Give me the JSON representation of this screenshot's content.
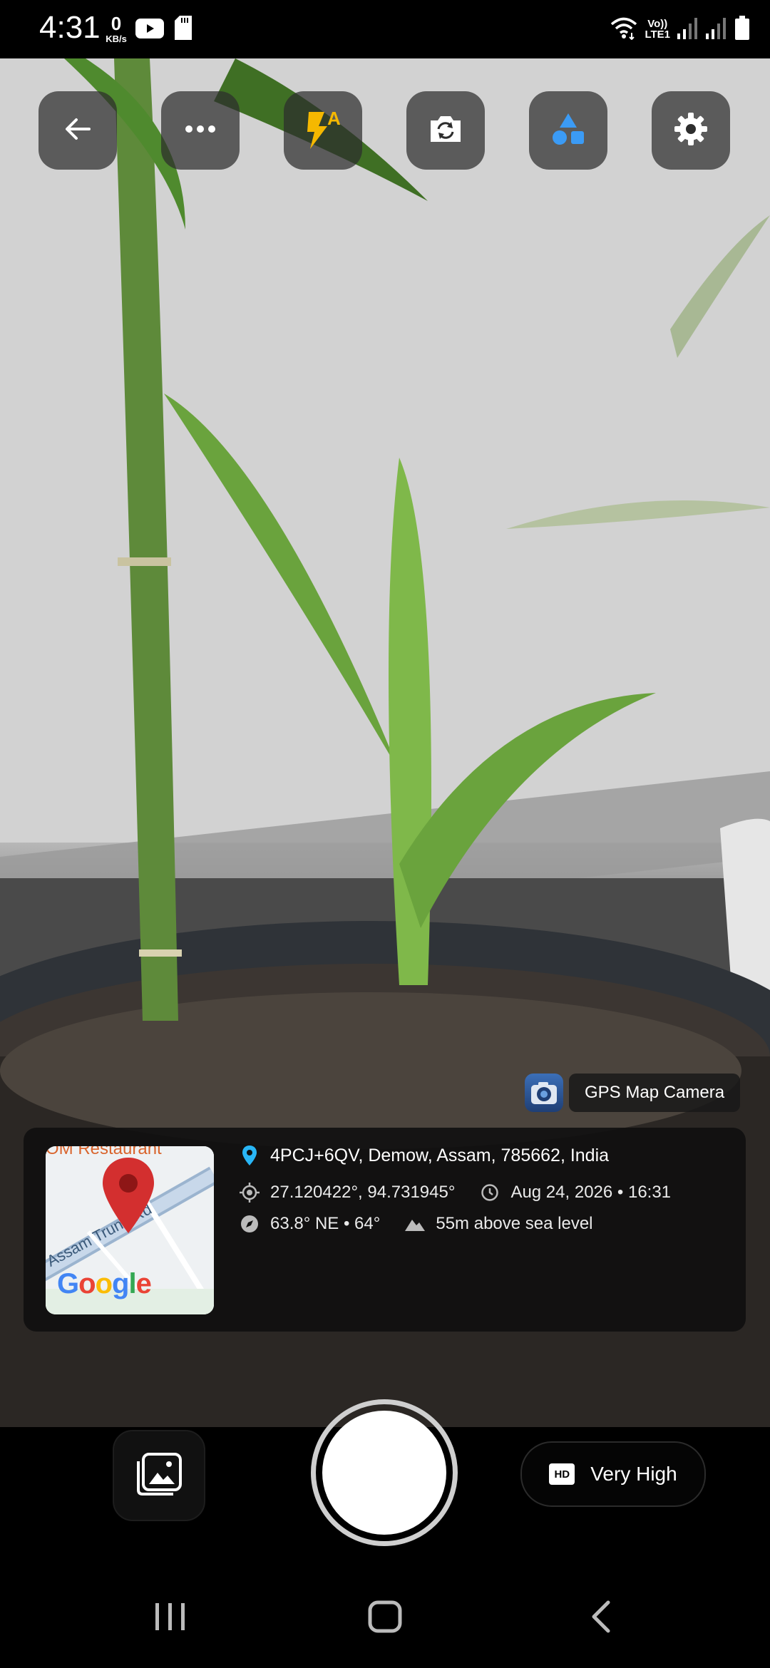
{
  "status_bar": {
    "time": "4:31",
    "net_speed_value": "0",
    "net_speed_unit": "KB/s",
    "volte_top": "Vo))",
    "volte_bottom": "LTE1",
    "icons": [
      "youtube-icon",
      "sd-card-icon",
      "wifi-icon",
      "signal-icon",
      "signal-icon",
      "battery-icon"
    ]
  },
  "top_controls": {
    "icons": [
      "back-arrow-icon",
      "more-icon",
      "flash-auto-icon",
      "switch-camera-icon",
      "shapes-icon",
      "settings-icon"
    ],
    "flash_badge": "A",
    "accent_flash": "#f5b800",
    "accent_shapes": "#3b9bf5"
  },
  "gps": {
    "app_label": "GPS Map Camera",
    "address": "4PCJ+6QV, Demow, Assam, 785662, India",
    "coordinates": "27.120422°, 94.731945°",
    "datetime": "Aug 24, 2026 • 16:31",
    "compass": "63.8° NE • 64°",
    "altitude": "55m above sea level",
    "map": {
      "poi_label": "OM Restaurant",
      "road_label": "Assam Trunk Rd",
      "brand": "Google",
      "pin_color": "#d32f2f",
      "pin_icon": "location-pin-icon"
    },
    "address_pin_color": "#29b6f6"
  },
  "bottom": {
    "quality_badge": "HD",
    "quality_label": "Very High"
  },
  "nav": {
    "icons": [
      "recent-apps-icon",
      "home-icon",
      "back-icon"
    ]
  }
}
